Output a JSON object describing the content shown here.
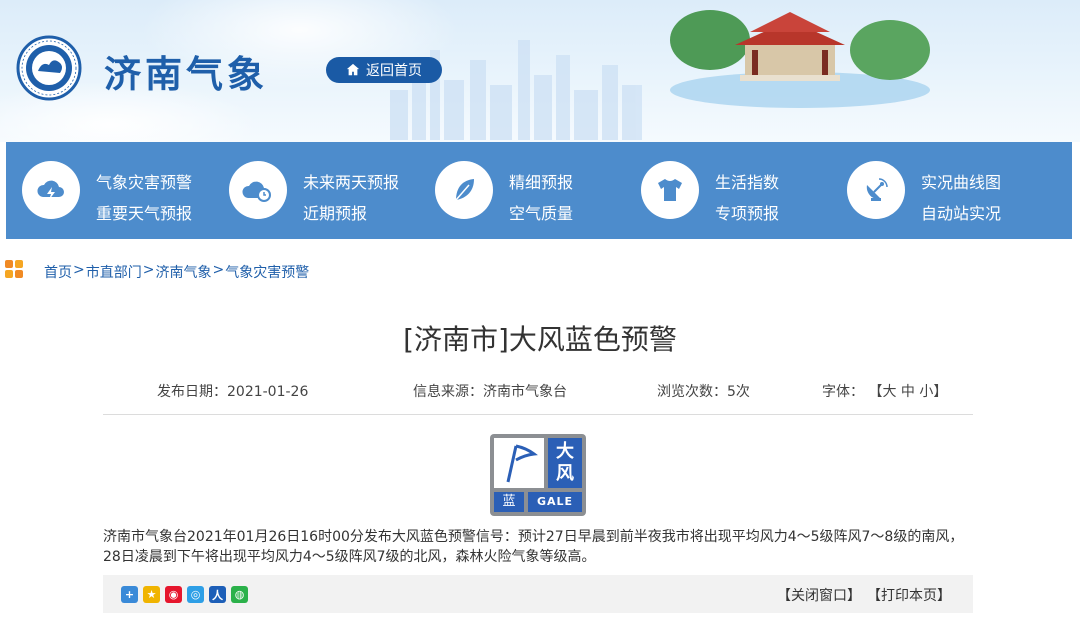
{
  "header": {
    "site_title": "济南气象",
    "home_label": "返回首页"
  },
  "nav": [
    {
      "icon": "cloud-lightning-icon",
      "links": [
        "气象灾害预警",
        "重要天气预报"
      ]
    },
    {
      "icon": "cloud-clock-icon",
      "links": [
        "未来两天预报",
        "近期预报"
      ]
    },
    {
      "icon": "leaf-icon",
      "links": [
        "精细预报",
        "空气质量"
      ]
    },
    {
      "icon": "tshirt-icon",
      "links": [
        "生活指数",
        "专项预报"
      ]
    },
    {
      "icon": "satellite-dish-icon",
      "links": [
        "实况曲线图",
        "自动站实况"
      ]
    }
  ],
  "breadcrumb": [
    "首页",
    "市直部门",
    "济南气象",
    "气象灾害预警"
  ],
  "article": {
    "title": "[济南市]大风蓝色预警",
    "meta": {
      "date_label": "发布日期：2021-01-26",
      "source_label": "信息来源：济南市气象台",
      "views_label": "浏览次数：5次",
      "font_label": "字体：",
      "font_sizes": "【大 中 小】"
    },
    "warning_icon": {
      "top_text": "大风",
      "level": "蓝",
      "english": "GALE",
      "color": "#2b5fb6"
    },
    "body": "济南市气象台2021年01月26日16时00分发布大风蓝色预警信号：预计27日早晨到前半夜我市将出现平均风力4～5级阵风7～8级的南风，28日凌晨到下午将出现平均风力4～5级阵风7级的北风，森林火险气象等级高。"
  },
  "footer": {
    "close_label": "【关闭窗口】",
    "print_label": "【打印本页】"
  },
  "colors": {
    "nav_bg": "#4d8ccc",
    "brand": "#1f5faa"
  }
}
